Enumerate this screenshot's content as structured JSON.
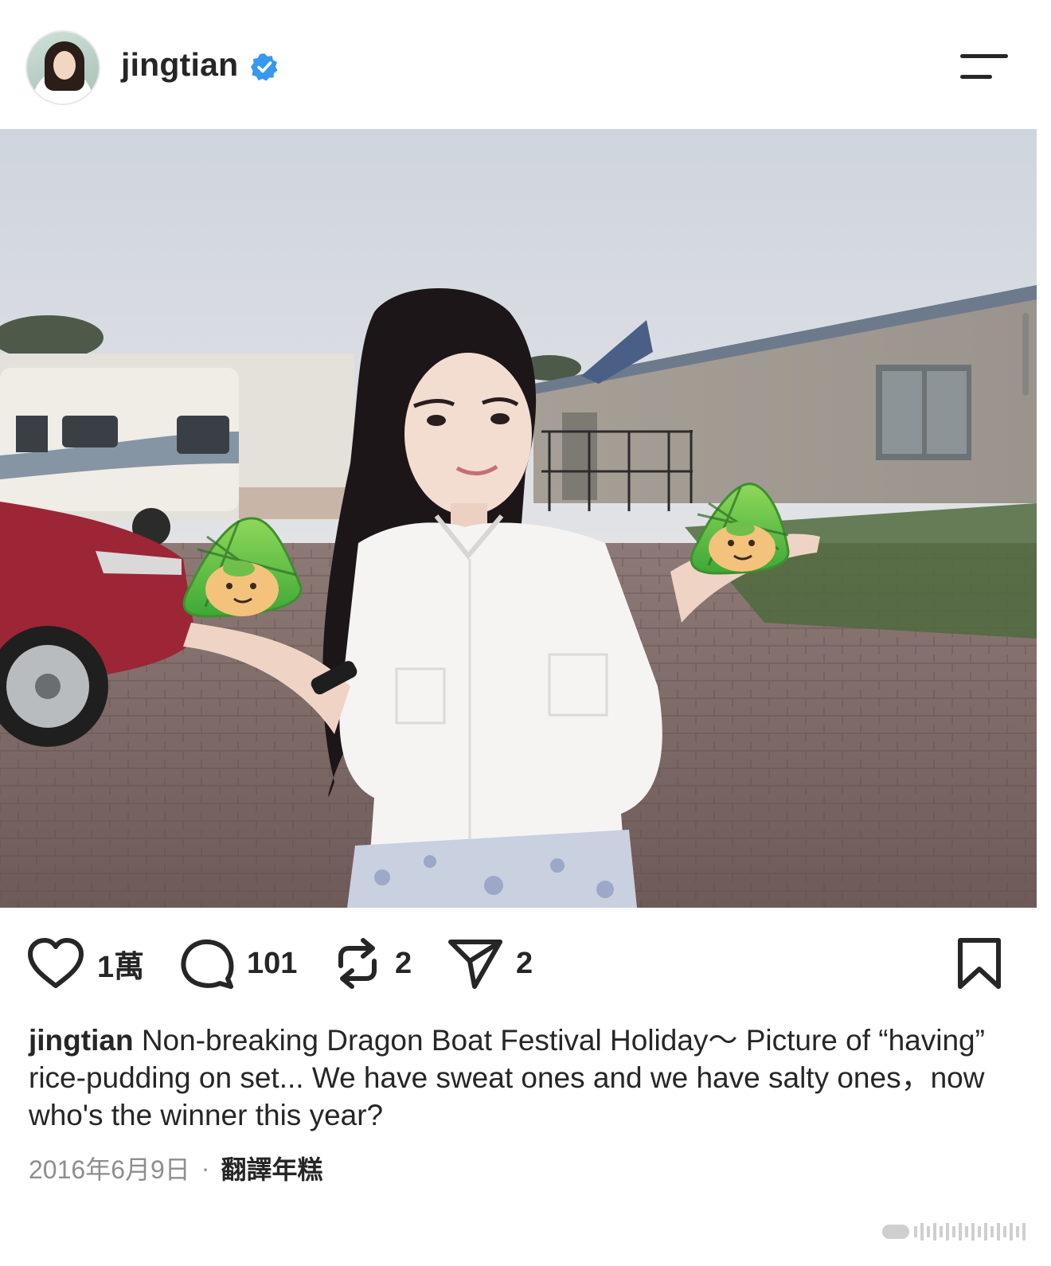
{
  "header": {
    "username": "jingtian",
    "verified_icon": "verified-badge-icon",
    "menu_icon": "menu-icon"
  },
  "colors": {
    "verified_blue": "#3897f0",
    "text": "#262626",
    "muted": "#8e8e8e"
  },
  "post": {
    "image_alt": "Woman in white blouse holding two green rice-dumpling stickers on a film set",
    "actions": {
      "like_count": "1萬",
      "comment_count": "101",
      "repost_count": "2",
      "share_count": "2"
    },
    "caption": {
      "username": "jingtian",
      "text": " Non-breaking Dragon Boat Festival Holiday～  Picture of “having” rice-pudding on set... We have sweat ones and we have salty ones，now who's the winner this year?"
    },
    "date": "2016年6月9日",
    "separator": "·",
    "translate_label": "翻譯年糕"
  }
}
